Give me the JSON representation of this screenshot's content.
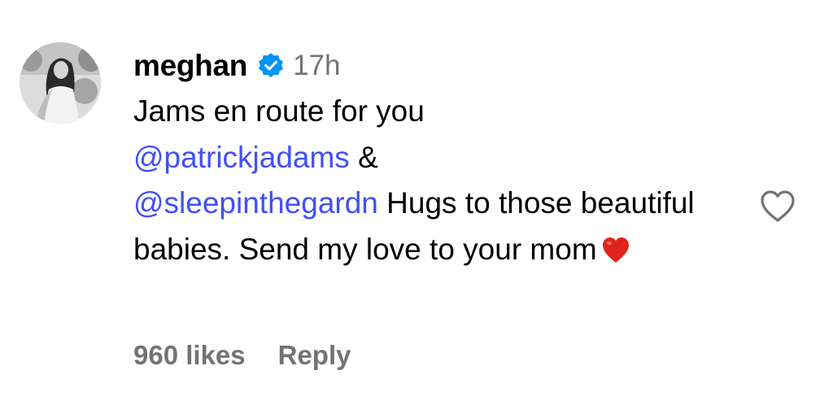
{
  "comment": {
    "username": "meghan",
    "verified": true,
    "time": "17h",
    "text_intro": "Jams en route for you",
    "mention_1": "@patrickjadams",
    "separator": " &",
    "mention_2": "@sleepinthegardn",
    "text_after_mention": " Hugs to those beautiful babies. Send my love to your mom",
    "emoji": "red-heart-emoji",
    "likes_label": "960 likes",
    "reply_label": "Reply",
    "icons": {
      "avatar": "profile-photo",
      "verified": "verified-badge-icon",
      "like": "heart-outline-icon"
    },
    "colors": {
      "mention": "#4150f7",
      "secondary_text": "#737373",
      "verified_badge": "#0095f6",
      "emoji_heart": "#e0241b"
    }
  }
}
